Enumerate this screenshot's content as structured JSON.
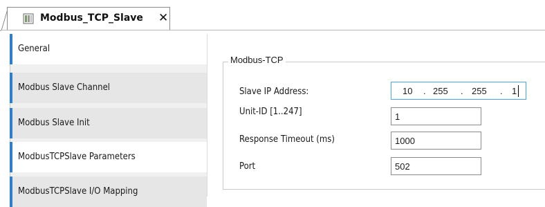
{
  "tab": {
    "title": "Modbus_TCP_Slave",
    "close_glyph": "✕",
    "icon": "device-icon"
  },
  "sidebar": {
    "items": [
      {
        "label": "General",
        "state": "active"
      },
      {
        "label": "Modbus Slave Channel",
        "state": "normal"
      },
      {
        "label": "Modbus Slave Init",
        "state": "normal"
      },
      {
        "label": "ModbusTCPSlave Parameters",
        "state": "selected"
      },
      {
        "label": "ModbusTCPSlave I/O Mapping",
        "state": "normal"
      }
    ]
  },
  "group": {
    "title": "Modbus-TCP"
  },
  "fields": {
    "ip": {
      "label": "Slave IP Address:",
      "octets": [
        "10",
        "255",
        "255",
        "1"
      ],
      "separator": "."
    },
    "unit_id": {
      "label": "Unit-ID [1..247]",
      "value": "1"
    },
    "timeout": {
      "label": "Response Timeout (ms)",
      "value": "1000"
    },
    "port": {
      "label": "Port",
      "value": "502"
    }
  },
  "colors": {
    "accent": "#2c7fd0",
    "focus_border": "#4aa3e8"
  }
}
